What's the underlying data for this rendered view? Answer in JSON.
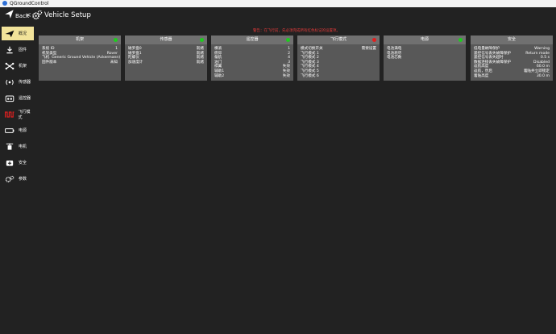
{
  "window": {
    "title": "QGroundControl"
  },
  "header": {
    "back_label": "Back",
    "back_chevron": "<",
    "title": "Vehicle Setup"
  },
  "warning": "警告：在飞行前，先必须完成所有红色标记的设置项。",
  "sidebar": {
    "items": [
      {
        "label": "概况",
        "icon": "plane-icon"
      },
      {
        "label": "固件",
        "icon": "download-icon"
      },
      {
        "label": "机架",
        "icon": "airframe-icon"
      },
      {
        "label": "传感器",
        "icon": "sensors-icon"
      },
      {
        "label": "遥控器",
        "icon": "radio-icon"
      },
      {
        "label": "飞行模式",
        "icon": "wave-icon"
      },
      {
        "label": "电源",
        "icon": "battery-icon"
      },
      {
        "label": "电机",
        "icon": "motor-icon"
      },
      {
        "label": "安全",
        "icon": "safety-icon"
      },
      {
        "label": "参数",
        "icon": "gears-icon"
      }
    ]
  },
  "cards": [
    {
      "title": "机架",
      "status_color": "#1ecb1e",
      "rows": [
        {
          "label": "系统 ID",
          "value": "1"
        },
        {
          "label": "机架类型",
          "value": "Rover"
        },
        {
          "label": "飞机",
          "value": "Generic Ground Vehicle (Ackermann)"
        },
        {
          "label": "固件版本",
          "value": "未知"
        }
      ]
    },
    {
      "title": "传感器",
      "status_color": "#1ecb1e",
      "rows": [
        {
          "label": "磁罗盘0",
          "value": "就绪"
        },
        {
          "label": "磁罗盘1",
          "value": "就绪"
        },
        {
          "label": "陀螺仪",
          "value": "就绪"
        },
        {
          "label": "加速度计",
          "value": "就绪"
        }
      ]
    },
    {
      "title": "遥控器",
      "status_color": "#1ecb1e",
      "rows": [
        {
          "label": "横滚",
          "value": "1"
        },
        {
          "label": "俯仰",
          "value": "2"
        },
        {
          "label": "偏航",
          "value": "4"
        },
        {
          "label": "油门",
          "value": "3"
        },
        {
          "label": "襟翼",
          "value": "失效"
        },
        {
          "label": "辅助1",
          "value": "失效"
        },
        {
          "label": "辅助2",
          "value": "失效"
        }
      ]
    },
    {
      "title": "飞行模式",
      "status_color": "#e02020",
      "rows": [
        {
          "label": "模式切换开关",
          "value": "需要设置"
        },
        {
          "label": "飞行模式 1",
          "value": ""
        },
        {
          "label": "飞行模式 2",
          "value": ""
        },
        {
          "label": "飞行模式 3",
          "value": ""
        },
        {
          "label": "飞行模式 4",
          "value": ""
        },
        {
          "label": "飞行模式 5",
          "value": ""
        },
        {
          "label": "飞行模式 6",
          "value": ""
        }
      ]
    },
    {
      "title": "电源",
      "status_color": "#1ecb1e",
      "rows": [
        {
          "label": "电池满电",
          "value": ""
        },
        {
          "label": "电池耗尽",
          "value": ""
        },
        {
          "label": "电池芯数",
          "value": ""
        }
      ]
    },
    {
      "title": "安全",
      "status_color": "",
      "rows": [
        {
          "label": "低电量故障保护",
          "value": "Warning"
        },
        {
          "label": "遥控信号丢失故障保护",
          "value": "Return mode"
        },
        {
          "label": "遥控信号丢失超时",
          "value": "0.5 s"
        },
        {
          "label": "数据连接丢失故障保护",
          "value": "Disabled"
        },
        {
          "label": "返航高度",
          "value": "60.0 m"
        },
        {
          "label": "返航，然后",
          "value": "着陆并立即锁定"
        },
        {
          "label": "着陆高度",
          "value": "30.0 m"
        }
      ]
    }
  ]
}
